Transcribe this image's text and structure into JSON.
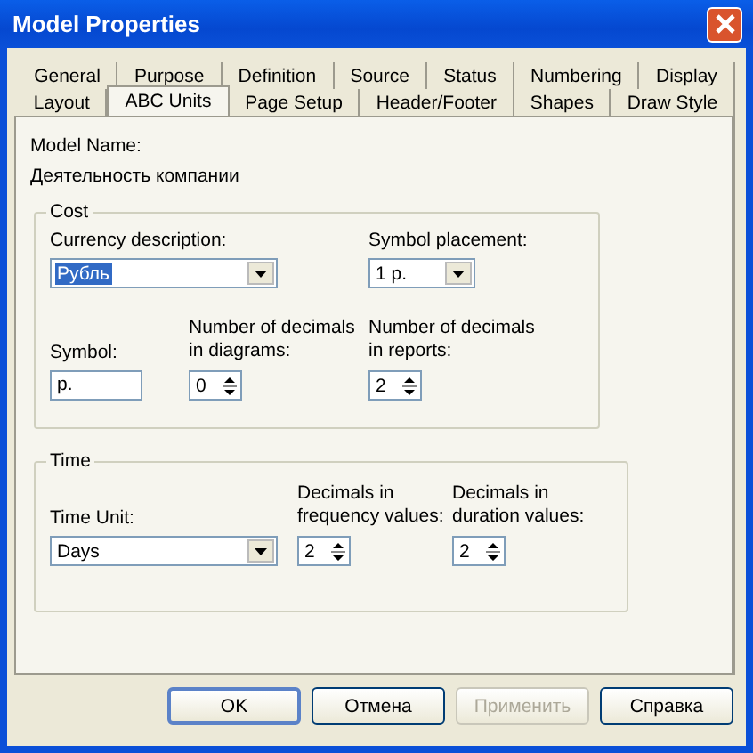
{
  "window": {
    "title": "Model Properties"
  },
  "tab_rows": [
    [
      {
        "label": "General",
        "selected": false
      },
      {
        "label": "Purpose",
        "selected": false
      },
      {
        "label": "Definition",
        "selected": false
      },
      {
        "label": "Source",
        "selected": false
      },
      {
        "label": "Status",
        "selected": false
      },
      {
        "label": "Numbering",
        "selected": false
      },
      {
        "label": "Display",
        "selected": false
      }
    ],
    [
      {
        "label": "Layout",
        "selected": false
      },
      {
        "label": "ABC Units",
        "selected": true
      },
      {
        "label": "Page Setup",
        "selected": false
      },
      {
        "label": "Header/Footer",
        "selected": false
      },
      {
        "label": "Shapes",
        "selected": false
      },
      {
        "label": "Draw Style",
        "selected": false
      }
    ]
  ],
  "model_name": {
    "label": "Model Name:",
    "value": "Деятельность компании"
  },
  "cost": {
    "title": "Cost",
    "currency": {
      "label": "Currency description:",
      "value": "Рубль",
      "text_selected": true
    },
    "symbol_placement": {
      "label": "Symbol placement:",
      "value": "1 р."
    },
    "symbol": {
      "label": "Symbol:",
      "value": "р."
    },
    "decimals_diagrams": {
      "label": "Number of decimals in diagrams:",
      "value": "0"
    },
    "decimals_reports": {
      "label": "Number of decimals in reports:",
      "value": "2"
    }
  },
  "time": {
    "title": "Time",
    "time_unit": {
      "label": "Time Unit:",
      "value": "Days"
    },
    "decimals_frequency": {
      "label": "Decimals in frequency values:",
      "value": "2"
    },
    "decimals_duration": {
      "label": "Decimals in duration values:",
      "value": "2"
    }
  },
  "buttons": [
    {
      "label": "OK",
      "default": true,
      "disabled": false
    },
    {
      "label": "Отмена",
      "default": false,
      "disabled": false
    },
    {
      "label": "Применить",
      "default": false,
      "disabled": true
    },
    {
      "label": "Справка",
      "default": false,
      "disabled": false
    }
  ]
}
